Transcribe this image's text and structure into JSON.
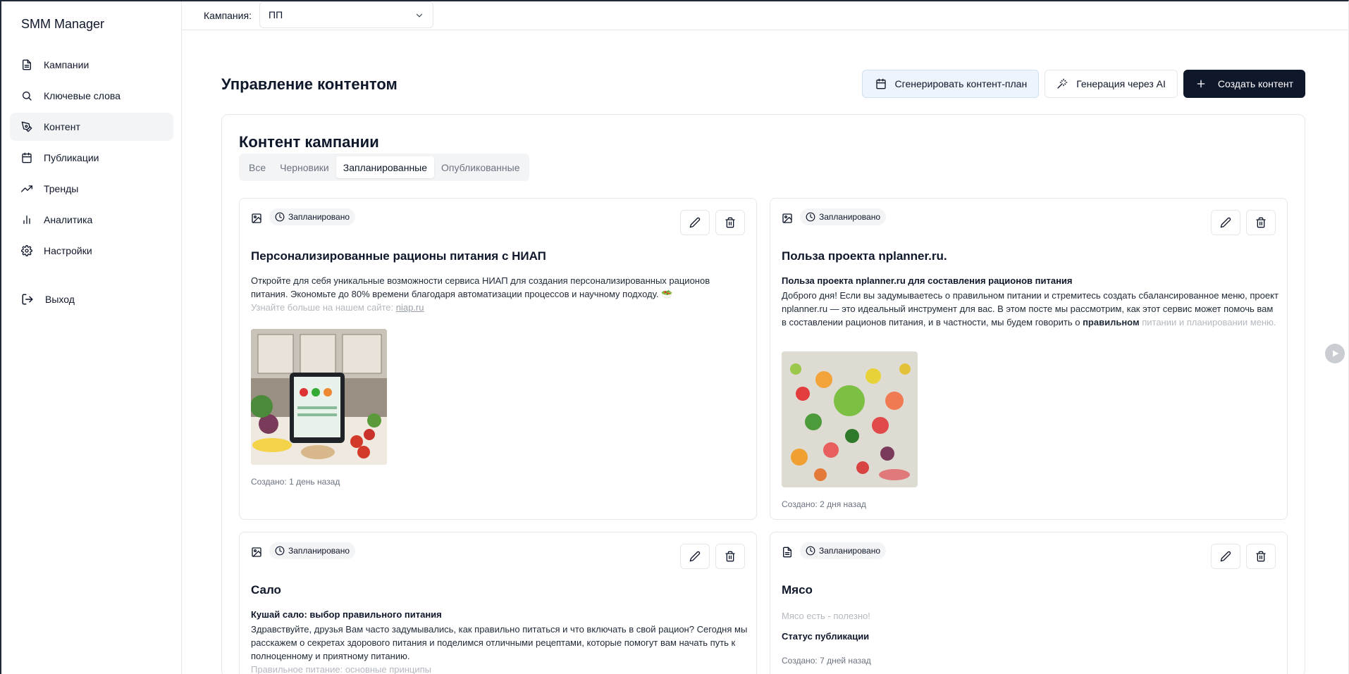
{
  "app": {
    "title": "SMM Manager"
  },
  "sidebar": {
    "items": [
      {
        "label": "Кампании",
        "icon": "document-icon",
        "active": false
      },
      {
        "label": "Ключевые слова",
        "icon": "search-icon",
        "active": false
      },
      {
        "label": "Контент",
        "icon": "pen-tool-icon",
        "active": true
      },
      {
        "label": "Публикации",
        "icon": "calendar-icon",
        "active": false
      },
      {
        "label": "Тренды",
        "icon": "trending-up-icon",
        "active": false
      },
      {
        "label": "Аналитика",
        "icon": "bar-chart-icon",
        "active": false
      },
      {
        "label": "Настройки",
        "icon": "gear-icon",
        "active": false
      }
    ],
    "logout_label": "Выход"
  },
  "topbar": {
    "campaign_label": "Кампания:",
    "campaign_value": "ПП"
  },
  "header": {
    "title": "Управление контентом",
    "actions": {
      "generate_plan": "Сгенерировать контент-план",
      "ai_generate": "Генерация через AI",
      "create": "Создать контент"
    }
  },
  "panel": {
    "title": "Контент кампании",
    "tabs": [
      {
        "label": "Все",
        "active": false
      },
      {
        "label": "Черновики",
        "active": false
      },
      {
        "label": "Запланированные",
        "active": true
      },
      {
        "label": "Опубликованные",
        "active": false
      }
    ]
  },
  "cards": [
    {
      "type_icon": "image-icon",
      "status": "Запланировано",
      "title": "Персонализированные рационы питания с НИАП",
      "subtitle": "",
      "body": "Откройте для себя уникальные возможности сервиса НИАП для создания персонализированных рационов питания. Экономьте до 80% времени благодаря автоматизации процессов и научному подходу. 🥗",
      "body_faded": "Узнайте больше на нашем сайте: ",
      "body_link": "niap.ru",
      "image": "kitchen-tablet-vegetables",
      "created": "Создано: 1 день назад"
    },
    {
      "type_icon": "image-icon",
      "status": "Запланировано",
      "title": "Польза проекта nplanner.ru.",
      "subtitle": "Польза проекта nplanner.ru для составления рационов питания",
      "body": "Доброго дня! Если вы задумываетесь о правильном питании и стремитесь создать сбалансированное меню, проект nplanner.ru — это идеальный инструмент для вас. В этом посте мы рассмотрим, как этот сервис может помочь вам в составлении рационов питания, и в частности, мы будем говорить о ",
      "body_bold": "правильном",
      "body_faded": "питании и планировании меню.",
      "image": "fruits-vegetables-flatlay",
      "created": "Создано: 2 дня назад"
    },
    {
      "type_icon": "image-icon",
      "status": "Запланировано",
      "title": "Сало",
      "subtitle": "Кушай сало: выбор правильного питания",
      "body": "Здравствуйте, друзья Вам часто задумывались, как правильно питаться и что включать в свой рацион? Сегодня мы расскажем о секретах здорового питания и поделимся отличными рецептами, которые помогут вам начать путь к полноценному и приятному питанию.",
      "body_faded": "Правильное питание: основные принципы"
    },
    {
      "type_icon": "text-file-icon",
      "status": "Запланировано",
      "title": "Мясо",
      "body_faded": "Мясо есть - полезно!",
      "status_label": "Статус публикации",
      "created": "Создано: 7 дней назад"
    }
  ],
  "colors": {
    "primary": "#0f172a",
    "soft_button": "#eef4fb",
    "muted": "#6b7280",
    "border": "#e5e7eb",
    "tab_bg": "#f3f4f6"
  }
}
